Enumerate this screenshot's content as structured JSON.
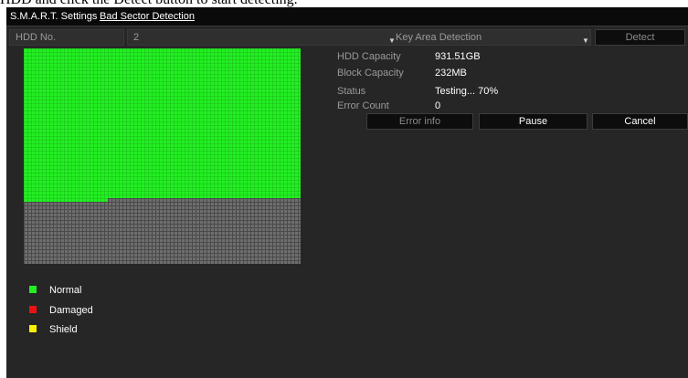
{
  "caption": "HDD and click the Detect button to start detecting.",
  "tabs": [
    {
      "label": "S.M.A.R.T. Settings",
      "active": false
    },
    {
      "label": "Bad Sector Detection",
      "active": true
    }
  ],
  "controls": {
    "hdd_label": "HDD No.",
    "hdd_value": "2",
    "detect_type": "Key Area Detection",
    "detect_button": "Detect"
  },
  "info": {
    "hdd_capacity_label": "HDD Capacity",
    "hdd_capacity_value": "931.51GB",
    "block_capacity_label": "Block Capacity",
    "block_capacity_value": "232MB",
    "status_label": "Status",
    "status_value": "Testing... 70%",
    "error_count_label": "Error Count",
    "error_count_value": "0"
  },
  "progress": 0.7,
  "actions": {
    "error_info": "Error info",
    "pause": "Pause",
    "cancel": "Cancel"
  },
  "legend": [
    {
      "label": "Normal",
      "color": "#22ee22"
    },
    {
      "label": "Damaged",
      "color": "#ee1111"
    },
    {
      "label": "Shield",
      "color": "#ffee00"
    }
  ]
}
